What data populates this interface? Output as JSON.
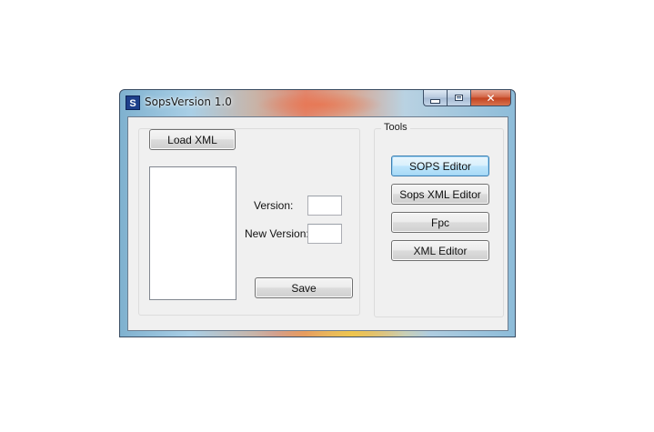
{
  "window": {
    "title": "SopsVersion 1.0",
    "icon_letter": "S",
    "icon_name": "app-s-icon",
    "caption": {
      "minimize_icon": "minimize-icon",
      "maximize_icon": "maximize-icon",
      "close_glyph": "✕"
    }
  },
  "left_panel": {
    "load_button": "Load XML",
    "version_label": "Version:",
    "version_value": "",
    "new_version_label": "New Version:",
    "new_version_value": "",
    "save_button": "Save"
  },
  "tools": {
    "legend": "Tools",
    "buttons": [
      "SOPS Editor",
      "Sops XML Editor",
      "Fpc",
      "XML Editor"
    ]
  },
  "colors": {
    "accent_focus": "#3c7fb1",
    "close_button": "#c2421f",
    "client_bg": "#f0f0f0"
  }
}
